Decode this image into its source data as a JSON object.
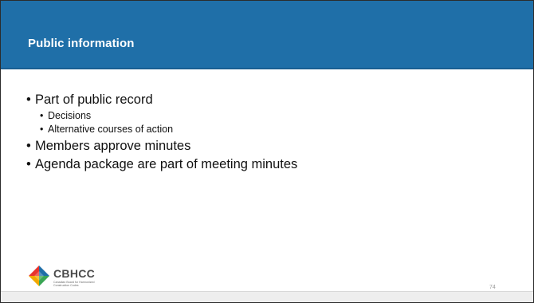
{
  "slide": {
    "title": "Public information",
    "page_number": "74",
    "header_color": "#1f6fa8"
  },
  "content": {
    "bullets": [
      {
        "text": "Part of public record",
        "sub": [
          "Decisions",
          "Alternative courses of action"
        ]
      },
      {
        "text": "Members approve minutes"
      },
      {
        "text": "Agenda package are part of meeting minutes"
      }
    ]
  },
  "logo": {
    "name": "CBHCC",
    "tagline": "Canadian Board for Harmonized Construction Codes",
    "colors": [
      "#1f6fa8",
      "#e8342e",
      "#3aa655",
      "#f2a900"
    ]
  }
}
